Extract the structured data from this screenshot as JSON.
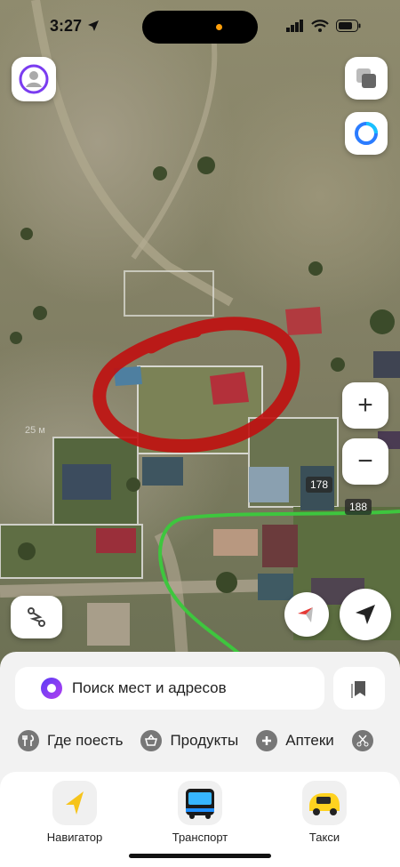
{
  "status_bar": {
    "time": "3:27",
    "location_icon": "location-arrow-icon",
    "signal_icon": "cellular-signal-icon",
    "wifi_icon": "wifi-icon",
    "battery_icon": "battery-icon"
  },
  "map": {
    "house_numbers": [
      "178",
      "188"
    ],
    "scale_hint": "25 м",
    "colors": {
      "annotation_red": "#c01010",
      "route_green": "#3ec63e",
      "roof_red": "#b3303a"
    }
  },
  "map_controls": {
    "profile_icon": "profile-icon",
    "layers_icon": "layers-icon",
    "alice_icon": "alice-assistant-icon",
    "zoom_in_label": "+",
    "zoom_out_label": "−",
    "route_icon": "route-icon",
    "compass_icon": "compass-icon",
    "my_location_icon": "my-location-arrow-icon"
  },
  "search": {
    "placeholder": "Поиск мест и адресов",
    "alice_icon": "alice-icon",
    "bookmark_icon": "bookmarks-icon"
  },
  "categories": [
    {
      "label": "Где поесть",
      "icon": "fork-knife-icon"
    },
    {
      "label": "Продукты",
      "icon": "basket-icon"
    },
    {
      "label": "Аптеки",
      "icon": "pharmacy-cross-icon"
    },
    {
      "label": "",
      "icon": "scissors-icon"
    }
  ],
  "tabs": [
    {
      "label": "Навигатор",
      "icon": "navigator-arrow-icon"
    },
    {
      "label": "Транспорт",
      "icon": "bus-icon"
    },
    {
      "label": "Такси",
      "icon": "taxi-car-icon"
    }
  ]
}
